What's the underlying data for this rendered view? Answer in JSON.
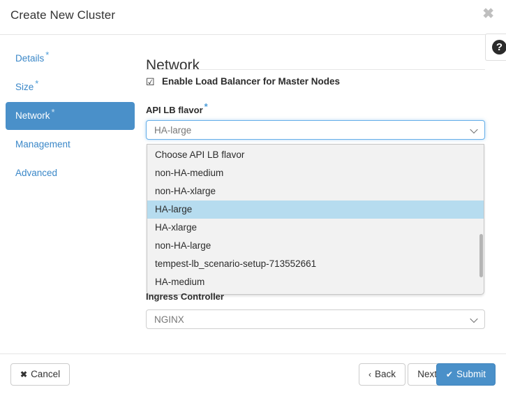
{
  "header": {
    "title": "Create New Cluster",
    "close_label": "✖"
  },
  "sidebar": {
    "items": [
      {
        "label": "Details",
        "required": "*",
        "active": false
      },
      {
        "label": "Size",
        "required": "*",
        "active": false
      },
      {
        "label": "Network",
        "required": "*",
        "active": true
      },
      {
        "label": "Management",
        "required": "",
        "active": false
      },
      {
        "label": "Advanced",
        "required": "",
        "active": false
      }
    ]
  },
  "pane": {
    "title": "Network",
    "checkbox": {
      "glyph": "☑",
      "label": "Enable Load Balancer for Master Nodes",
      "checked": true
    },
    "api_lb_flavor": {
      "label": "API LB flavor",
      "required": "*",
      "value": "HA-large",
      "expanded": true,
      "options": [
        "Choose API LB flavor",
        "non-HA-medium",
        "non-HA-xlarge",
        "HA-large",
        "HA-xlarge",
        "non-HA-large",
        "tempest-lb_scenario-setup-713552661",
        "HA-medium"
      ],
      "selected_option": "HA-large"
    },
    "ingress_controller": {
      "label": "Ingress Controller",
      "value": "NGINX"
    }
  },
  "help": {
    "icon_label": "?"
  },
  "footer": {
    "cancel": {
      "label": "Cancel",
      "glyph": "✖"
    },
    "back": {
      "label": "Back",
      "glyph": "‹"
    },
    "next": {
      "label": "Next",
      "glyph": "›"
    },
    "submit": {
      "label": "Submit",
      "glyph": "✔"
    }
  },
  "colors": {
    "accent": "#4a90c9",
    "link": "#3a87c8",
    "highlight": "#b6dcef",
    "border": "#cccccc"
  }
}
